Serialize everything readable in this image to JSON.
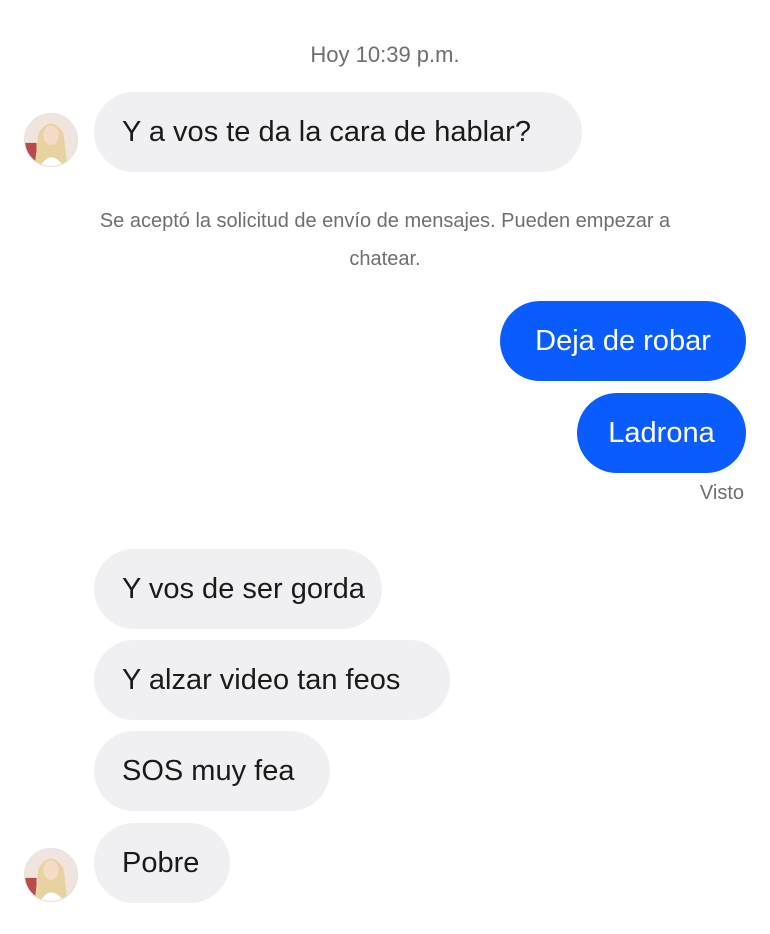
{
  "chat": {
    "timestamp": "Hoy 10:39 p.m.",
    "system_notice": "Se aceptó la solicitud de envío de mensajes. Pueden empezar a chatear.",
    "seen_label": "Visto",
    "messages": [
      {
        "direction": "incoming",
        "text": "Y a vos te da la cara de hablar?"
      },
      {
        "direction": "outgoing",
        "text": "Deja de robar"
      },
      {
        "direction": "outgoing",
        "text": "Ladrona"
      },
      {
        "direction": "incoming",
        "text": "Y vos de ser gorda"
      },
      {
        "direction": "incoming",
        "text": "Y alzar video tan feos"
      },
      {
        "direction": "incoming",
        "text": "SOS muy fea"
      },
      {
        "direction": "incoming",
        "text": "Pobre"
      }
    ]
  },
  "colors": {
    "outgoing_bubble": "#0a5cff",
    "incoming_bubble": "#f0f0f2",
    "secondary_text": "#6e6e73"
  },
  "icons": {
    "avatar": "contact-avatar-photo"
  }
}
